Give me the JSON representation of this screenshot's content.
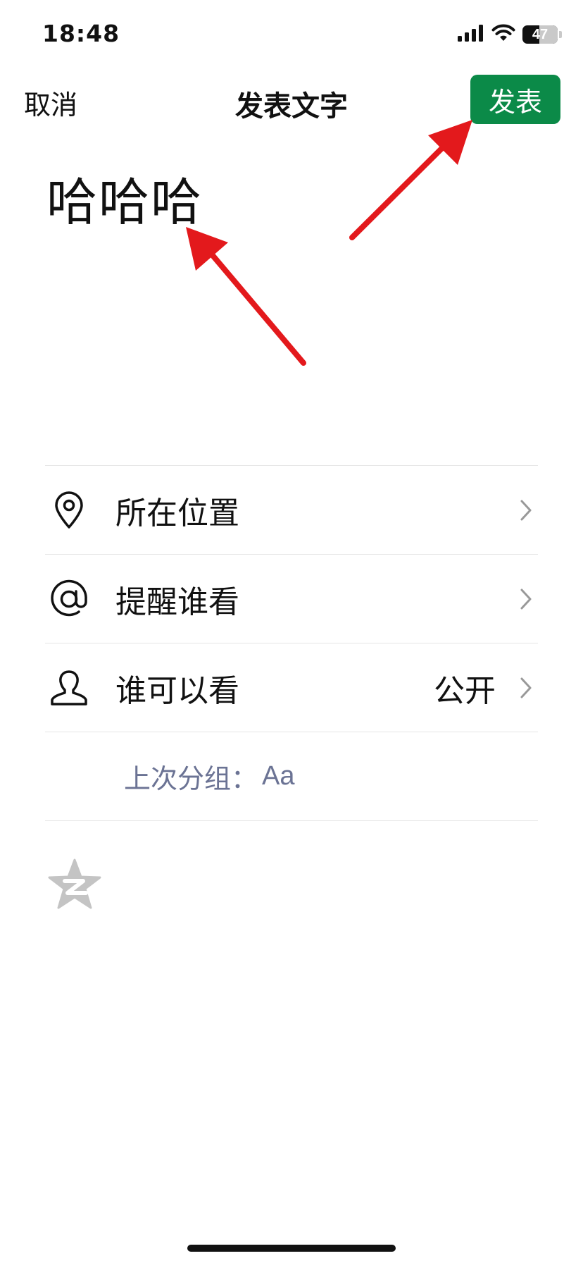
{
  "status_bar": {
    "time": "18:48",
    "battery": "47",
    "battery_level": 0.47,
    "icons": [
      "signal-icon",
      "wifi-icon",
      "battery-icon"
    ]
  },
  "nav": {
    "cancel_label": "取消",
    "title": "发表文字",
    "publish_label": "发表"
  },
  "post": {
    "text": "哈哈哈"
  },
  "options": {
    "location_label": "所在位置",
    "mention_label": "提醒谁看",
    "visibility_label": "谁可以看",
    "visibility_value": "公开",
    "last_group_label": "上次分组：",
    "last_group_value": "Aa"
  },
  "colors": {
    "publish_bg": "#0b8a48",
    "accent_text": "#6b7394",
    "annotation_arrow": "#e3191c"
  }
}
